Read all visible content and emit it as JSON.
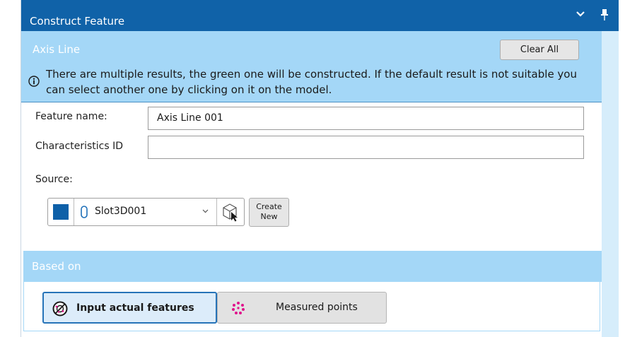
{
  "panel": {
    "title": "Construct Feature"
  },
  "axis_section": {
    "title": "Axis Line",
    "clear_all_label": "Clear All",
    "info_text": "There are multiple results, the green one will be constructed. If the default result is not suitable you can select another one by clicking on it on the model."
  },
  "form": {
    "feature_name_label": "Feature name:",
    "feature_name_value": "Axis Line 001",
    "characteristics_label": "Characteristics ID",
    "characteristics_value": "",
    "source_label": "Source:",
    "source_value": "Slot3D001",
    "create_new_line1": "Create",
    "create_new_line2": "New",
    "source_color": "#0e60a8"
  },
  "based_on": {
    "title": "Based on",
    "options": [
      {
        "label": "Input actual features",
        "selected": true,
        "icon": "features-icon"
      },
      {
        "label": "Measured points",
        "selected": false,
        "icon": "points-icon"
      }
    ]
  },
  "colors": {
    "titlebar": "#1062a8",
    "section_header": "#a4d7f7",
    "accent": "#2673b8",
    "points_magenta": "#e0138c"
  }
}
